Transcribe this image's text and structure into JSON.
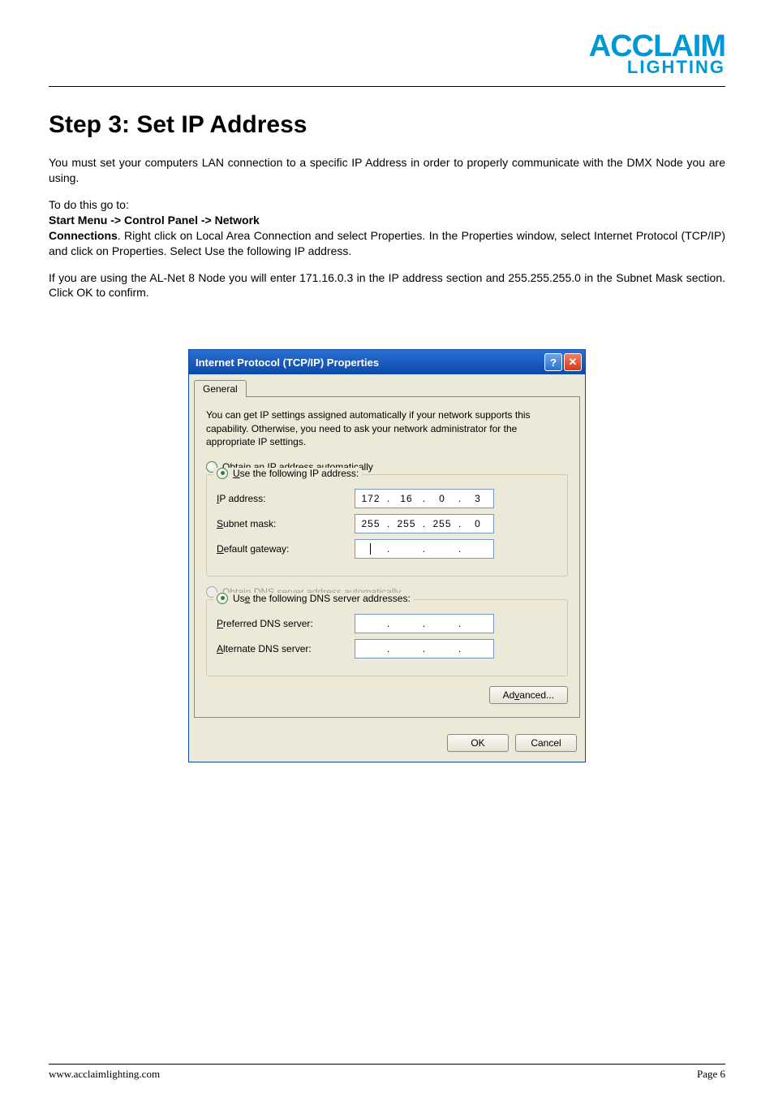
{
  "logo": {
    "line1": "ACCLAIM",
    "line2": "LIGHTING"
  },
  "heading": "Step 3: Set IP Address",
  "para1": "You must set your computers LAN connection to a specific IP Address in order to properly communicate with the DMX Node you are using.",
  "para2_intro": "To do this go to:",
  "para2_bold": "Start Menu -> Control Panel -> Network",
  "para2_rest_bold": "Connections",
  "para2_rest": ". Right click on Local Area Connection and select Properties. In the Properties window, select Internet Protocol (TCP/IP) and click on Properties. Select Use the following IP address.",
  "para3": "If you are using the AL-Net 8 Node you will enter 171.16.0.3 in the IP address section and 255.255.255.0 in the Subnet Mask section. Click OK to confirm.",
  "dialog": {
    "title": "Internet Protocol (TCP/IP) Properties",
    "help_glyph": "?",
    "close_glyph": "✕",
    "tab": "General",
    "desc": "You can get IP settings assigned automatically if your network supports this capability. Otherwise, you need to ask your network administrator for the appropriate IP settings.",
    "radio_obtain_ip": "Obtain an IP address automatically",
    "radio_use_ip": "Use the following IP address:",
    "ip_label": "IP address:",
    "ip_value": {
      "o1": "172",
      "o2": "16",
      "o3": "0",
      "o4": "3"
    },
    "subnet_label": "Subnet mask:",
    "subnet_value": {
      "o1": "255",
      "o2": "255",
      "o3": "255",
      "o4": "0"
    },
    "gateway_label": "Default gateway:",
    "radio_obtain_dns": "Obtain DNS server address automatically",
    "radio_use_dns": "Use the following DNS server addresses:",
    "pref_dns_label": "Preferred DNS server:",
    "alt_dns_label": "Alternate DNS server:",
    "advanced_btn": "Advanced...",
    "ok_btn": "OK",
    "cancel_btn": "Cancel",
    "dot": "."
  },
  "footer": {
    "url": "www.acclaimlighting.com",
    "page": "Page 6"
  },
  "chart_data": null
}
